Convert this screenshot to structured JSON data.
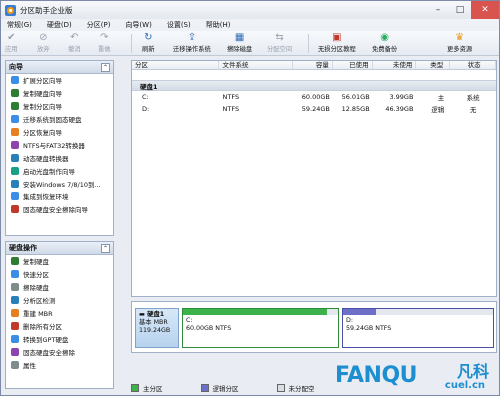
{
  "window": {
    "title": "分区助手企业版",
    "controls": [
      "–",
      "□",
      "✕"
    ]
  },
  "menu": [
    "常规(G)",
    "硬盘(D)",
    "分区(P)",
    "向导(W)",
    "设置(S)",
    "帮助(H)"
  ],
  "toolbar": {
    "buttons": [
      {
        "label": "应用",
        "icon": "check-icon",
        "glyph": "✔",
        "color": "#9aa2ad",
        "enabled": false
      },
      {
        "label": "放弃",
        "icon": "discard-icon",
        "glyph": "⊘",
        "color": "#9aa2ad",
        "enabled": false
      },
      {
        "label": "撤消",
        "icon": "undo-icon",
        "glyph": "↶",
        "color": "#9aa2ad",
        "enabled": false
      },
      {
        "label": "重做",
        "icon": "redo-icon",
        "glyph": "↷",
        "color": "#9aa2ad",
        "enabled": false
      },
      {
        "label": "刷新",
        "icon": "refresh-icon",
        "glyph": "↻",
        "color": "#2d6bb8",
        "enabled": true
      },
      {
        "label": "迁移操作系统",
        "icon": "migrate-os-icon",
        "glyph": "⇪",
        "color": "#2d6bb8",
        "enabled": true
      },
      {
        "label": "擦除磁盘",
        "icon": "wipe-disk-icon",
        "glyph": "▦",
        "color": "#2d6bb8",
        "enabled": true
      },
      {
        "label": "分配空间",
        "icon": "allocate-space-icon",
        "glyph": "⇆",
        "color": "#9aa2ad",
        "enabled": false
      },
      {
        "label": "无损分区教程",
        "icon": "tutorial-icon",
        "glyph": "▣",
        "color": "#c0392b",
        "enabled": true
      },
      {
        "label": "免费备份",
        "icon": "backup-icon",
        "glyph": "◉",
        "color": "#27ae60",
        "enabled": true
      },
      {
        "label": "更多资源",
        "icon": "more-resources-icon",
        "glyph": "♛",
        "color": "#e69b1e",
        "enabled": true
      }
    ]
  },
  "wizard_panel": {
    "title": "向导",
    "items": [
      {
        "label": "扩展分区向导",
        "color": "#3a8ee6"
      },
      {
        "label": "复制硬盘向导",
        "color": "#2e7d32"
      },
      {
        "label": "复制分区向导",
        "color": "#2e7d32"
      },
      {
        "label": "迁移系统到固态硬盘",
        "color": "#3a8ee6"
      },
      {
        "label": "分区恢复向导",
        "color": "#e67e22"
      },
      {
        "label": "NTFS与FAT32转换器",
        "color": "#8e44ad"
      },
      {
        "label": "动态硬盘转换器",
        "color": "#2980b9"
      },
      {
        "label": "启动光盘制作向导",
        "color": "#16a085"
      },
      {
        "label": "安装Windows 7/8/10到...",
        "color": "#2980b9"
      },
      {
        "label": "集成到恢复环境",
        "color": "#3a8ee6"
      },
      {
        "label": "固态硬盘安全擦除向导",
        "color": "#c0392b"
      }
    ]
  },
  "disk_ops_panel": {
    "title": "硬盘操作",
    "items": [
      {
        "label": "复制硬盘",
        "color": "#2e7d32"
      },
      {
        "label": "快速分区",
        "color": "#3a8ee6"
      },
      {
        "label": "擦除硬盘",
        "color": "#7f8c8d"
      },
      {
        "label": "分析区检测",
        "color": "#2980b9"
      },
      {
        "label": "重建 MBR",
        "color": "#e67e22"
      },
      {
        "label": "删除所有分区",
        "color": "#c0392b"
      },
      {
        "label": "转换到GPT硬盘",
        "color": "#3a8ee6"
      },
      {
        "label": "固态硬盘安全擦除",
        "color": "#8e44ad"
      },
      {
        "label": "属性",
        "color": "#7f8c8d"
      }
    ]
  },
  "table": {
    "columns": [
      "分区",
      "文件系统",
      "容量",
      "已使用",
      "未使用",
      "类型",
      "状态"
    ],
    "disk_label": "硬盘1",
    "rows": [
      {
        "partition": "C:",
        "fs": "NTFS",
        "capacity": "60.00GB",
        "used": "56.01GB",
        "unused": "3.99GB",
        "type": "主",
        "status": "系统"
      },
      {
        "partition": "D:",
        "fs": "NTFS",
        "capacity": "59.24GB",
        "used": "12.85GB",
        "unused": "46.39GB",
        "type": "逻辑",
        "status": "无"
      }
    ]
  },
  "disk_map": {
    "disk": {
      "name": "硬盘1",
      "kind": "基本 MBR",
      "size": "119.24GB"
    },
    "partitions": [
      {
        "label": "C:",
        "detail": "60.00GB NTFS",
        "used_fraction": 0.93,
        "fill": "#3bb34a",
        "border": "#2e8b3a"
      },
      {
        "label": "D:",
        "detail": "59.24GB NTFS",
        "used_fraction": 0.22,
        "fill": "#6d6fc8",
        "border": "#4a4fa6"
      }
    ]
  },
  "legend": [
    {
      "label": "主分区",
      "color": "#3bb34a"
    },
    {
      "label": "逻辑分区",
      "color": "#6d6fc8"
    },
    {
      "label": "未分配空",
      "color": "#d9dde4"
    }
  ],
  "watermark": {
    "brand": "FANQU",
    "site": "cuel.cn",
    "cn": "凡科"
  }
}
